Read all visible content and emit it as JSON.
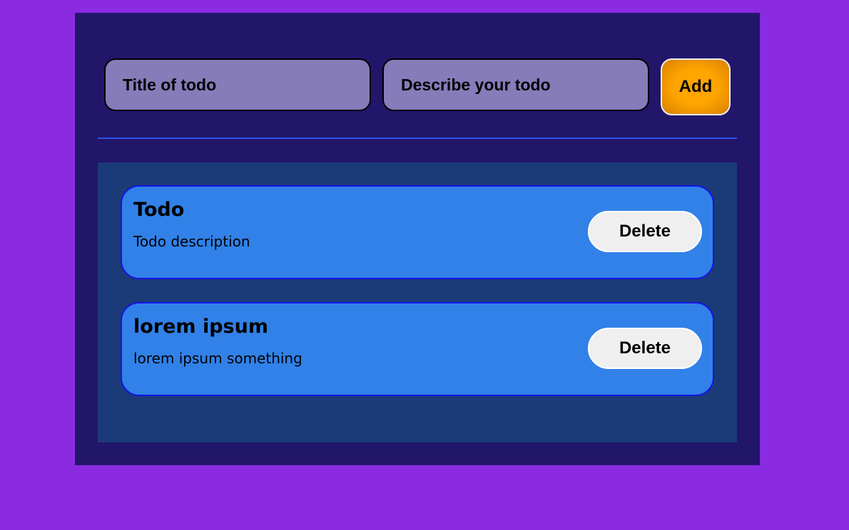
{
  "form": {
    "title_placeholder": "Title of todo",
    "description_placeholder": "Describe your todo",
    "add_label": "Add"
  },
  "todos": [
    {
      "title": "Todo",
      "description": "Todo description",
      "delete_label": "Delete"
    },
    {
      "title": "lorem ipsum",
      "description": "lorem ipsum something",
      "delete_label": "Delete"
    }
  ],
  "colors": {
    "page_background": "#8a2be2",
    "app_background": "#22166b",
    "input_background": "#857cb9",
    "add_button": "#ffa500",
    "divider": "#2a52e6",
    "list_background": "#1b3a78",
    "card_background": "#3181e8",
    "card_border": "#1414e6",
    "delete_button": "#efefef"
  }
}
